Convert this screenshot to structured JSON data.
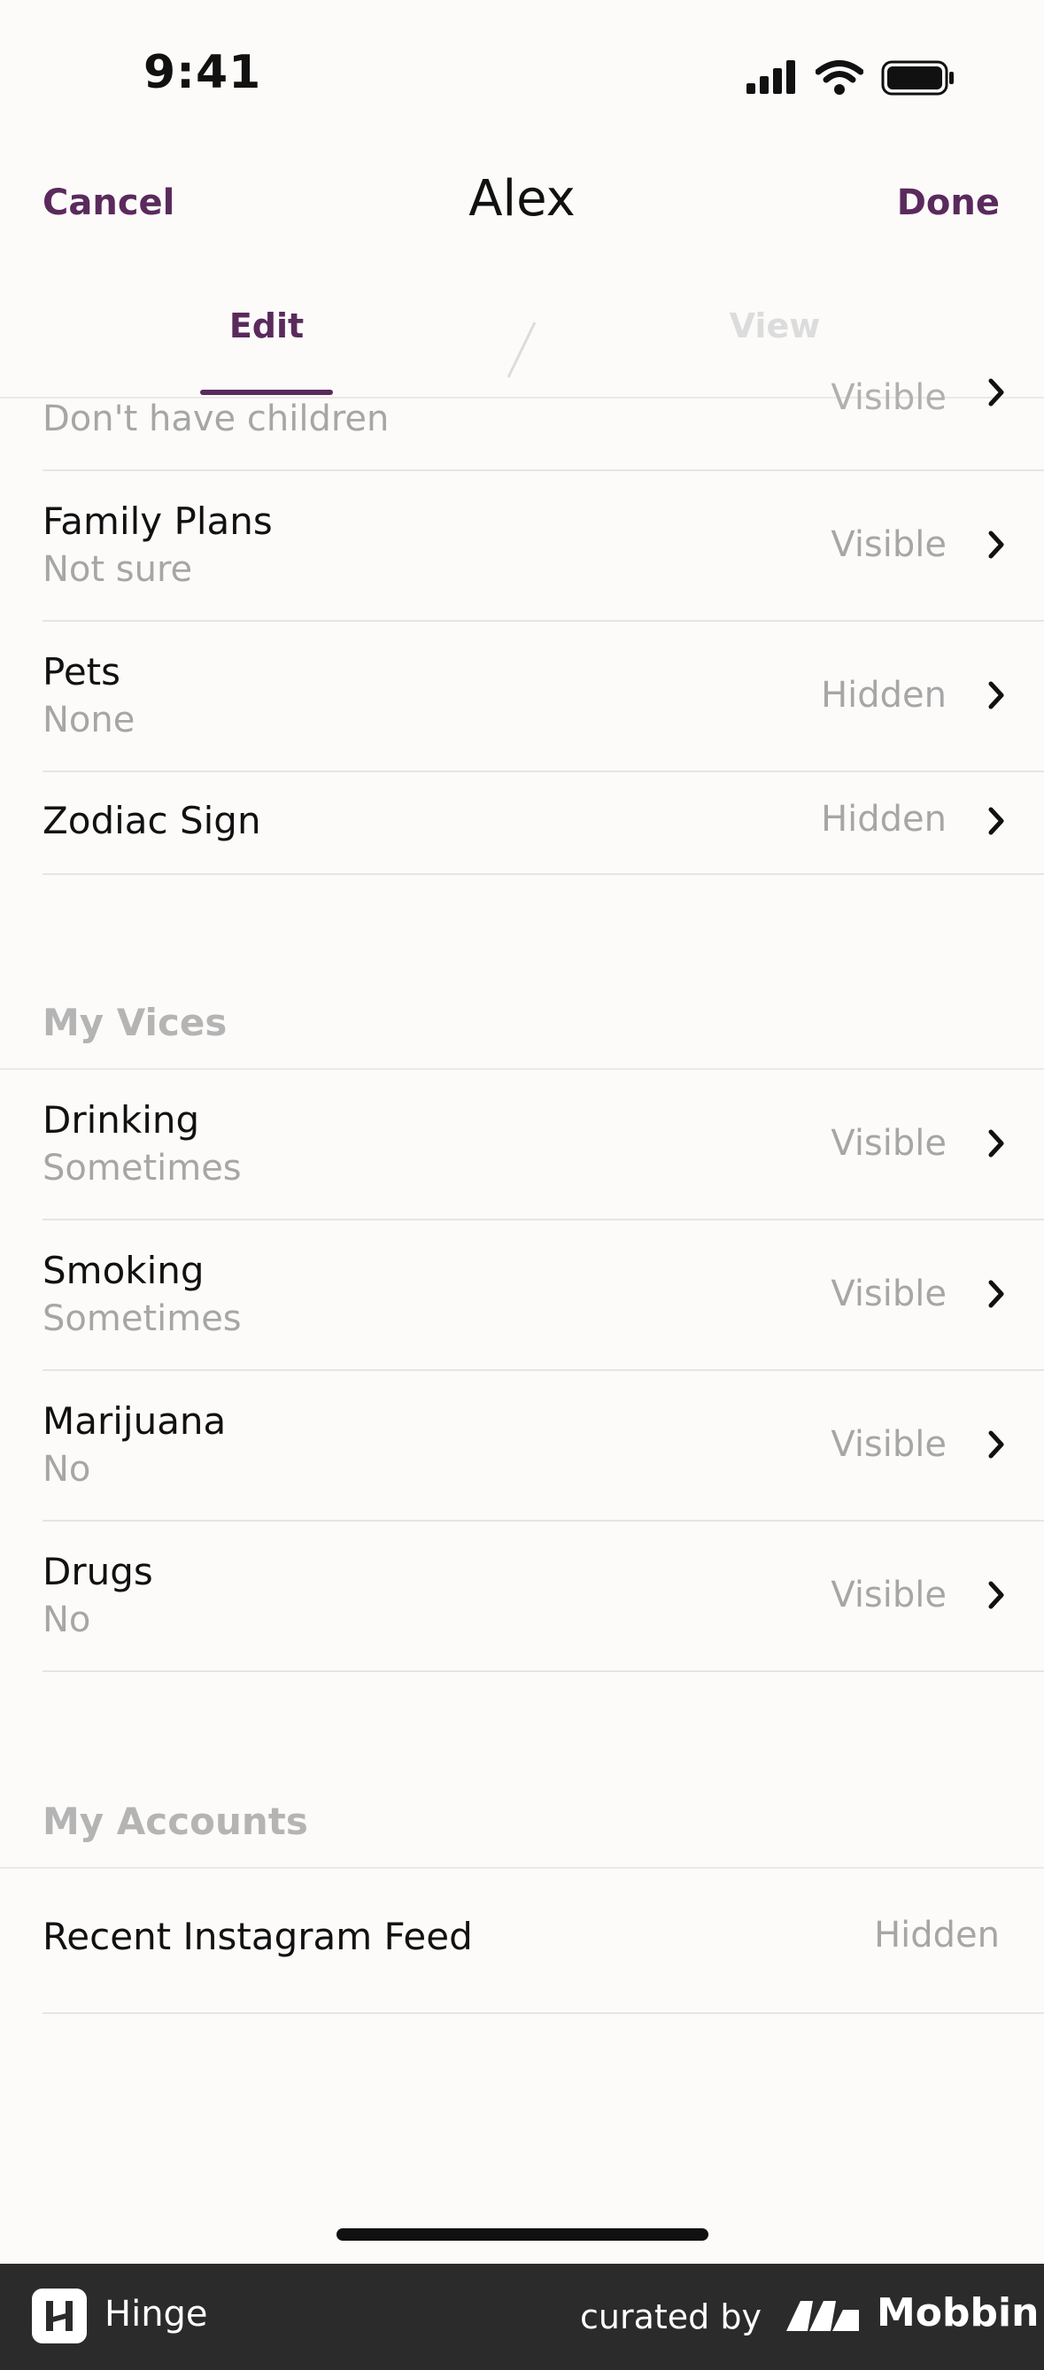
{
  "status_bar": {
    "time": "9:41"
  },
  "nav": {
    "cancel": "Cancel",
    "title": "Alex",
    "done": "Done"
  },
  "tabs": {
    "edit": "Edit",
    "view": "View"
  },
  "top_partial_row": {
    "subtitle": "Don't have children",
    "visibility": "Visible"
  },
  "rows_top": [
    {
      "title": "Family Plans",
      "subtitle": "Not sure",
      "visibility": "Visible"
    },
    {
      "title": "Pets",
      "subtitle": "None",
      "visibility": "Hidden"
    },
    {
      "title": "Zodiac Sign",
      "subtitle": "",
      "visibility": "Hidden"
    }
  ],
  "vices": {
    "title": "My Vices",
    "items": [
      {
        "title": "Drinking",
        "subtitle": "Sometimes",
        "visibility": "Visible"
      },
      {
        "title": "Smoking",
        "subtitle": "Sometimes",
        "visibility": "Visible"
      },
      {
        "title": "Marijuana",
        "subtitle": "No",
        "visibility": "Visible"
      },
      {
        "title": "Drugs",
        "subtitle": "No",
        "visibility": "Visible"
      }
    ]
  },
  "accounts": {
    "title": "My Accounts",
    "items": [
      {
        "title": "Recent Instagram Feed",
        "visibility": "Hidden"
      }
    ]
  },
  "footer": {
    "app_name": "Hinge",
    "curated_by": "curated by",
    "brand": "Mobbin"
  },
  "colors": {
    "accent": "#5a2a5c",
    "muted": "#a6a6a6",
    "footer_bg": "#2b2b2b"
  },
  "icons": [
    "cellular-signal-icon",
    "wifi-icon",
    "battery-icon",
    "chevron-right-icon",
    "hinge-logo-icon",
    "mobbin-logo-icon"
  ]
}
